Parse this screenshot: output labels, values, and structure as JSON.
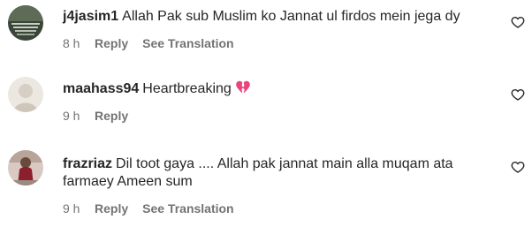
{
  "comments": [
    {
      "username": "j4jasim1",
      "text": "Allah Pak sub Muslim ko Jannat ul firdos mein jega dy",
      "time": "8 h",
      "reply_label": "Reply",
      "translate_label": "See Translation"
    },
    {
      "username": "maahass94",
      "text": "Heartbreaking",
      "emoji": "broken-heart",
      "time": "9 h",
      "reply_label": "Reply"
    },
    {
      "username": "frazriaz",
      "text_line1": "Dil toot gaya .... Allah pak jannat main alla muqam ata",
      "text_line2": "farmaey Ameen sum",
      "time": "9 h",
      "reply_label": "Reply",
      "translate_label": "See Translation"
    }
  ],
  "icons": {
    "like": "heart-outline-icon"
  },
  "colors": {
    "text": "#262626",
    "meta": "#737373",
    "broken_heart": "#e8457a"
  }
}
